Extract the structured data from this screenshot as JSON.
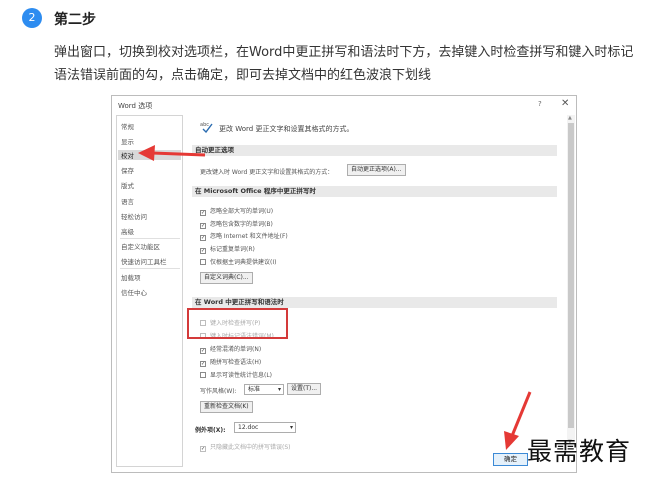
{
  "step": {
    "number": "2",
    "title": "第二步",
    "description": "弹出窗口，切换到校对选项栏，在Word中更正拼写和语法时下方，去掉键入时检查拼写和键入时标记语法错误前面的勾，点击确定，即可去掉文档中的红色波浪下划线"
  },
  "dialog": {
    "title": "Word 选项",
    "help": "?",
    "close": "✕",
    "categories": [
      {
        "label": "常规",
        "selected": false
      },
      {
        "label": "显示",
        "selected": false
      },
      {
        "label": "校对",
        "selected": true
      },
      {
        "label": "保存",
        "selected": false
      },
      {
        "label": "版式",
        "selected": false
      },
      {
        "label": "语言",
        "selected": false
      },
      {
        "label": "轻松访问",
        "selected": false
      },
      {
        "label": "高级",
        "selected": false
      },
      {
        "label": "自定义功能区",
        "selected": false
      },
      {
        "label": "快速访问工具栏",
        "selected": false
      },
      {
        "label": "加载项",
        "selected": false
      },
      {
        "label": "信任中心",
        "selected": false
      }
    ],
    "intro": "更改 Word 更正文字和设置其格式的方式。",
    "autocorrect": {
      "header": "自动更正选项",
      "text": "更改键入时 Word 更正文字和设置其格式的方式：",
      "button": "自动更正选项(A)..."
    },
    "office_section": {
      "header": "在 Microsoft Office 程序中更正拼写时",
      "options": [
        {
          "label": "忽略全部大写的单词(U)",
          "checked": true
        },
        {
          "label": "忽略包含数字的单词(B)",
          "checked": true
        },
        {
          "label": "忽略 Internet 和文件地址(F)",
          "checked": true
        },
        {
          "label": "标记重复单词(R)",
          "checked": true
        },
        {
          "label": "仅根据主词典提供建议(I)",
          "checked": false
        }
      ],
      "dictionary_button": "自定义词典(C)..."
    },
    "word_section": {
      "header": "在 Word 中更正拼写和语法时",
      "options": [
        {
          "label": "键入时检查拼写(P)",
          "checked": false
        },
        {
          "label": "键入时标记语法错误(M)",
          "checked": false
        },
        {
          "label": "经常混淆的单词(N)",
          "checked": true
        },
        {
          "label": "随拼写检查语法(H)",
          "checked": true
        },
        {
          "label": "显示可读性统计信息(L)",
          "checked": false
        }
      ],
      "style_label": "写作风格(W):",
      "style_value": "标准",
      "settings_button": "设置(T)...",
      "recheck_button": "重新检查文档(K)"
    },
    "exceptions": {
      "label": "例外项(X):",
      "file": "12.doc",
      "option": "只隐藏此文档中的拼写错误(S)"
    },
    "ok_button": "确定"
  },
  "watermark": "最需教育",
  "colors": {
    "badge": "#2d8cf0",
    "highlight": "#d43a3a",
    "arrow": "#e53935"
  }
}
